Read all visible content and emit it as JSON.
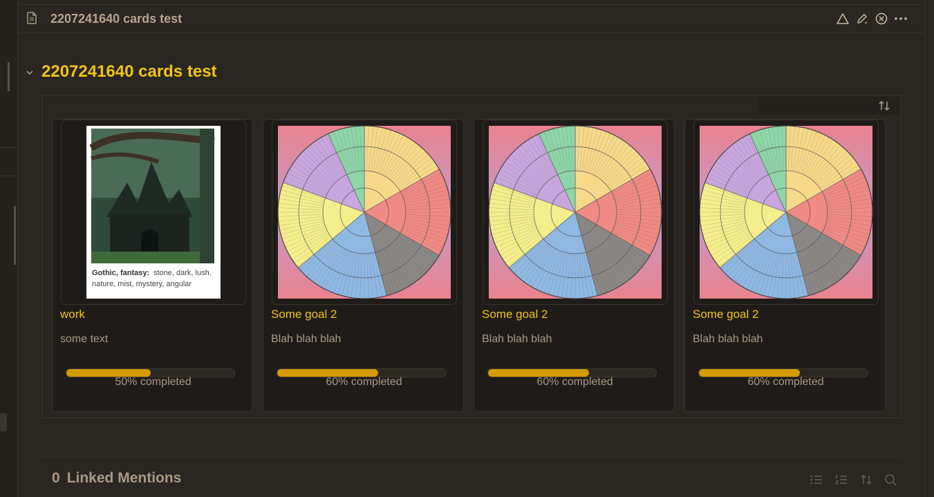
{
  "window": {
    "title": "2207241640 cards test"
  },
  "heading": {
    "title": "2207241640 cards test"
  },
  "cards": [
    {
      "title": "work",
      "text": "some text",
      "progress": 0.5,
      "progress_label": "50% completed",
      "image": "gothic-house",
      "image_caption_bold": "Gothic, fantasy:",
      "image_caption": "stone, dark, lush, nature, mist, mystery, angular"
    },
    {
      "title": "Some goal 2",
      "text": "Blah blah blah",
      "progress": 0.6,
      "progress_label": "60% completed",
      "image": "emotion-wheel"
    },
    {
      "title": "Some goal 2",
      "text": "Blah blah blah",
      "progress": 0.6,
      "progress_label": "60% completed",
      "image": "emotion-wheel"
    },
    {
      "title": "Some goal 2",
      "text": "Blah blah blah",
      "progress": 0.6,
      "progress_label": "60% completed",
      "image": "emotion-wheel"
    }
  ],
  "linked_mentions": {
    "count": "0",
    "label": "Linked Mentions"
  },
  "colors": {
    "accent": "#f0c419",
    "progress": "#d49a00",
    "background": "#2a2621",
    "card": "#1f1b18",
    "muted_text": "#a89a86"
  }
}
